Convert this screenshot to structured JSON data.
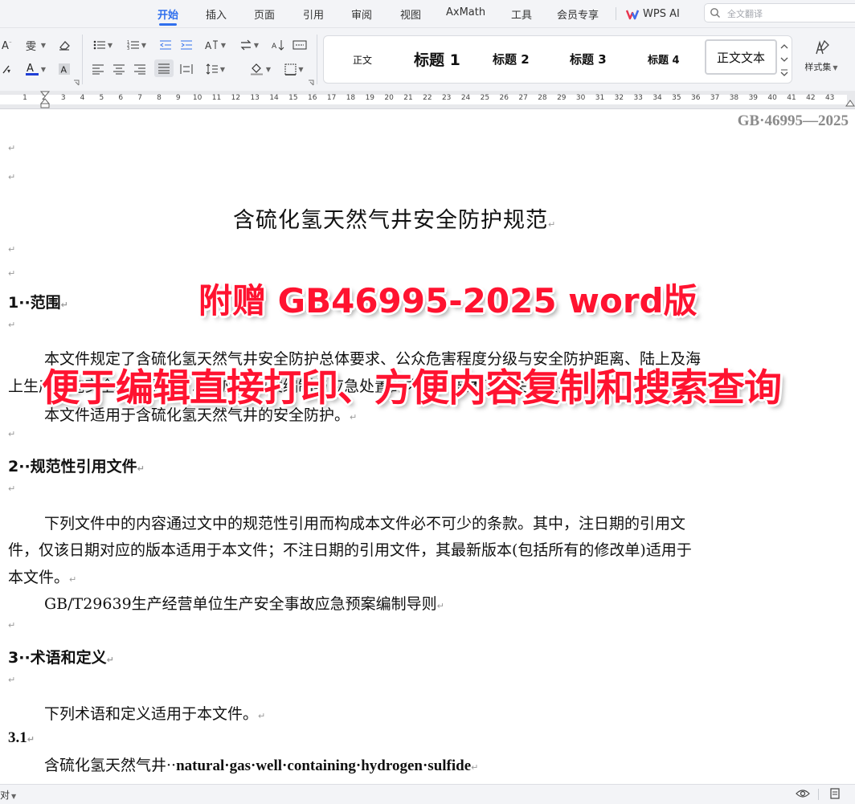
{
  "menu": {
    "tabs": [
      {
        "label": "开始",
        "active": true
      },
      {
        "label": "插入"
      },
      {
        "label": "页面"
      },
      {
        "label": "引用"
      },
      {
        "label": "审阅"
      },
      {
        "label": "视图"
      },
      {
        "label": "AxMath"
      },
      {
        "label": "工具"
      },
      {
        "label": "会员专享"
      }
    ],
    "wps_ai": "WPS AI",
    "search_placeholder": "全文翻译"
  },
  "ribbon": {
    "styles": {
      "normal": "正文",
      "heading1": "标题 1",
      "heading2": "标题 2",
      "heading3": "标题 3",
      "heading4": "标题 4",
      "body_text": "正文文本"
    },
    "style_set_label": "样式集",
    "accent_color": "#2f6fed",
    "font_color_bar": "#1f3fd6"
  },
  "ruler": {
    "numbers": [
      "1",
      "2",
      "3",
      "4",
      "5",
      "6",
      "7",
      "8",
      "9",
      "10",
      "11",
      "12",
      "13",
      "14",
      "15",
      "16",
      "17",
      "18",
      "19",
      "20",
      "21",
      "22",
      "23",
      "24",
      "25",
      "26",
      "27",
      "28",
      "29",
      "30",
      "31",
      "32",
      "33",
      "34",
      "35",
      "36",
      "37",
      "38",
      "39",
      "40",
      "41",
      "42",
      "43"
    ]
  },
  "document": {
    "header_standard": "GB·46995—2025",
    "title": "含硫化氢天然气井安全防护规范",
    "sections": {
      "s1_heading": "1··范围",
      "s1_para1_line1": "本文件规定了含硫化氢天然气井安全防护总体要求、公众危害程度分级与安全防护距离、陆上及海",
      "s1_para1_line2": "上生产设施安全防护要求，以及应急预案编制与应急处置的内容，描述了相关的证实方法。",
      "s1_para2": "本文件适用于含硫化氢天然气井的安全防护。",
      "s2_heading": "2··规范性引用文件",
      "s2_para1_line1": "下列文件中的内容通过文中的规范性引用而构成本文件必不可少的条款。其中，注日期的引用文",
      "s2_para1_line2": "件，仅该日期对应的版本适用于本文件；不注日期的引用文件，其最新版本(包括所有的修改单)适用于",
      "s2_para1_line3": "本文件。",
      "s2_ref": "GB/T29639生产经营单位生产安全事故应急预案编制导则",
      "s3_heading": "3··术语和定义",
      "s3_para": "下列术语和定义适用于本文件。",
      "s31_number": "3.1",
      "s31_term_cn": "含硫化氢天然气井··",
      "s31_term_en": "natural·gas·well·containing·hydrogen·sulfide"
    },
    "paragraph_mark": "↵"
  },
  "overlays": {
    "line1": "附赠 GB46995-2025 word版",
    "line2": "便于编辑直接打印、方便内容复制和搜索查询",
    "color": "#ff1330"
  },
  "status": {
    "left_text": "对"
  }
}
